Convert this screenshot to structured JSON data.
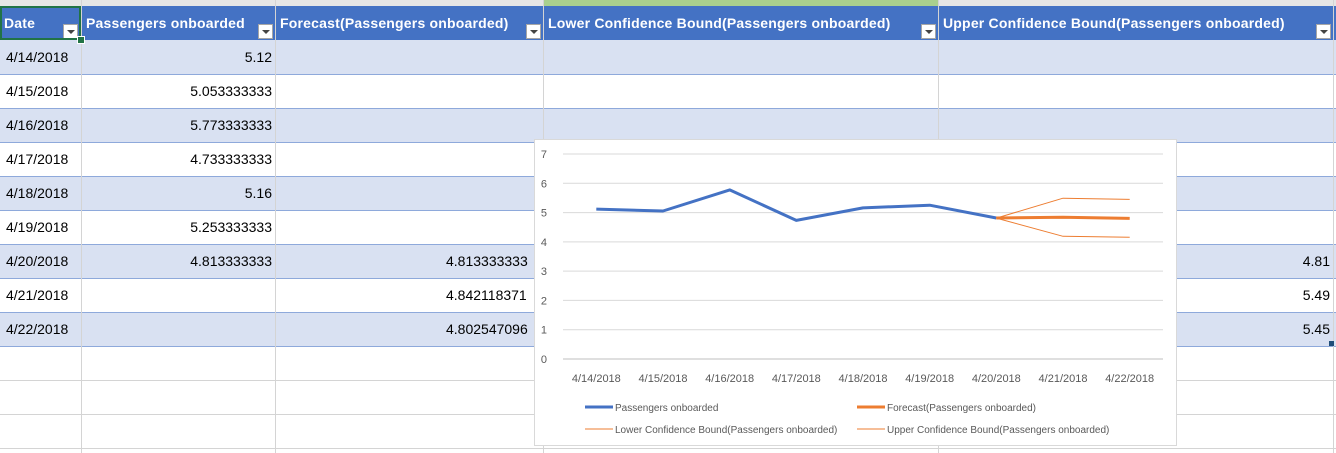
{
  "sheet": {
    "headers": [
      {
        "label": "Date"
      },
      {
        "label": "Passengers  onboarded"
      },
      {
        "label": "Forecast(Passengers  onboarded)"
      },
      {
        "label": "Lower  Confidence  Bound(Passengers  onboarded)"
      },
      {
        "label": "Upper  Confidence  Bound(Passengers  onboarded)"
      }
    ],
    "rows": [
      {
        "date": "4/14/2018",
        "pax": "5.12",
        "forecast": "",
        "lower": "",
        "upper": ""
      },
      {
        "date": "4/15/2018",
        "pax": "5.053333333",
        "forecast": "",
        "lower": "",
        "upper": ""
      },
      {
        "date": "4/16/2018",
        "pax": "5.773333333",
        "forecast": "",
        "lower": "",
        "upper": ""
      },
      {
        "date": "4/17/2018",
        "pax": "4.733333333",
        "forecast": "",
        "lower": "",
        "upper": ""
      },
      {
        "date": "4/18/2018",
        "pax": "5.16",
        "forecast": "",
        "lower": "",
        "upper": ""
      },
      {
        "date": "4/19/2018",
        "pax": "5.253333333",
        "forecast": "",
        "lower": "",
        "upper": ""
      },
      {
        "date": "4/20/2018",
        "pax": "4.813333333",
        "forecast": "4.813333333",
        "lower": "",
        "upper": "4.81"
      },
      {
        "date": "4/21/2018",
        "pax": "",
        "forecast": "4.842118371",
        "lower": "",
        "upper": "5.49"
      },
      {
        "date": "4/22/2018",
        "pax": "",
        "forecast": "4.802547096",
        "lower": "",
        "upper": "5.45"
      }
    ]
  },
  "colors": {
    "header_bg": "#4472c4",
    "band": "#d9e1f2",
    "actual": "#4472c4",
    "forecast": "#ed7d31"
  },
  "chart_data": {
    "type": "line",
    "categories": [
      "4/14/2018",
      "4/15/2018",
      "4/16/2018",
      "4/17/2018",
      "4/18/2018",
      "4/19/2018",
      "4/20/2018",
      "4/21/2018",
      "4/22/2018"
    ],
    "ylim": [
      0,
      7
    ],
    "yticks": [
      "0",
      "1",
      "2",
      "3",
      "4",
      "5",
      "6",
      "7"
    ],
    "grid": true,
    "legend_position": "bottom",
    "series": [
      {
        "name": "Passengers onboarded",
        "values": [
          5.12,
          5.053333333,
          5.773333333,
          4.733333333,
          5.16,
          5.253333333,
          4.813333333,
          null,
          null
        ],
        "color": "#4472c4",
        "weight": "thick"
      },
      {
        "name": "Forecast(Passengers onboarded)",
        "values": [
          null,
          null,
          null,
          null,
          null,
          null,
          4.813333333,
          4.842118371,
          4.802547096
        ],
        "color": "#ed7d31",
        "weight": "thick"
      },
      {
        "name": "Lower Confidence Bound(Passengers onboarded)",
        "values": [
          null,
          null,
          null,
          null,
          null,
          null,
          4.81,
          4.19,
          4.16
        ],
        "color": "#ed7d31",
        "weight": "thin"
      },
      {
        "name": "Upper Confidence Bound(Passengers onboarded)",
        "values": [
          null,
          null,
          null,
          null,
          null,
          null,
          4.81,
          5.49,
          5.45
        ],
        "color": "#ed7d31",
        "weight": "thin"
      }
    ]
  }
}
